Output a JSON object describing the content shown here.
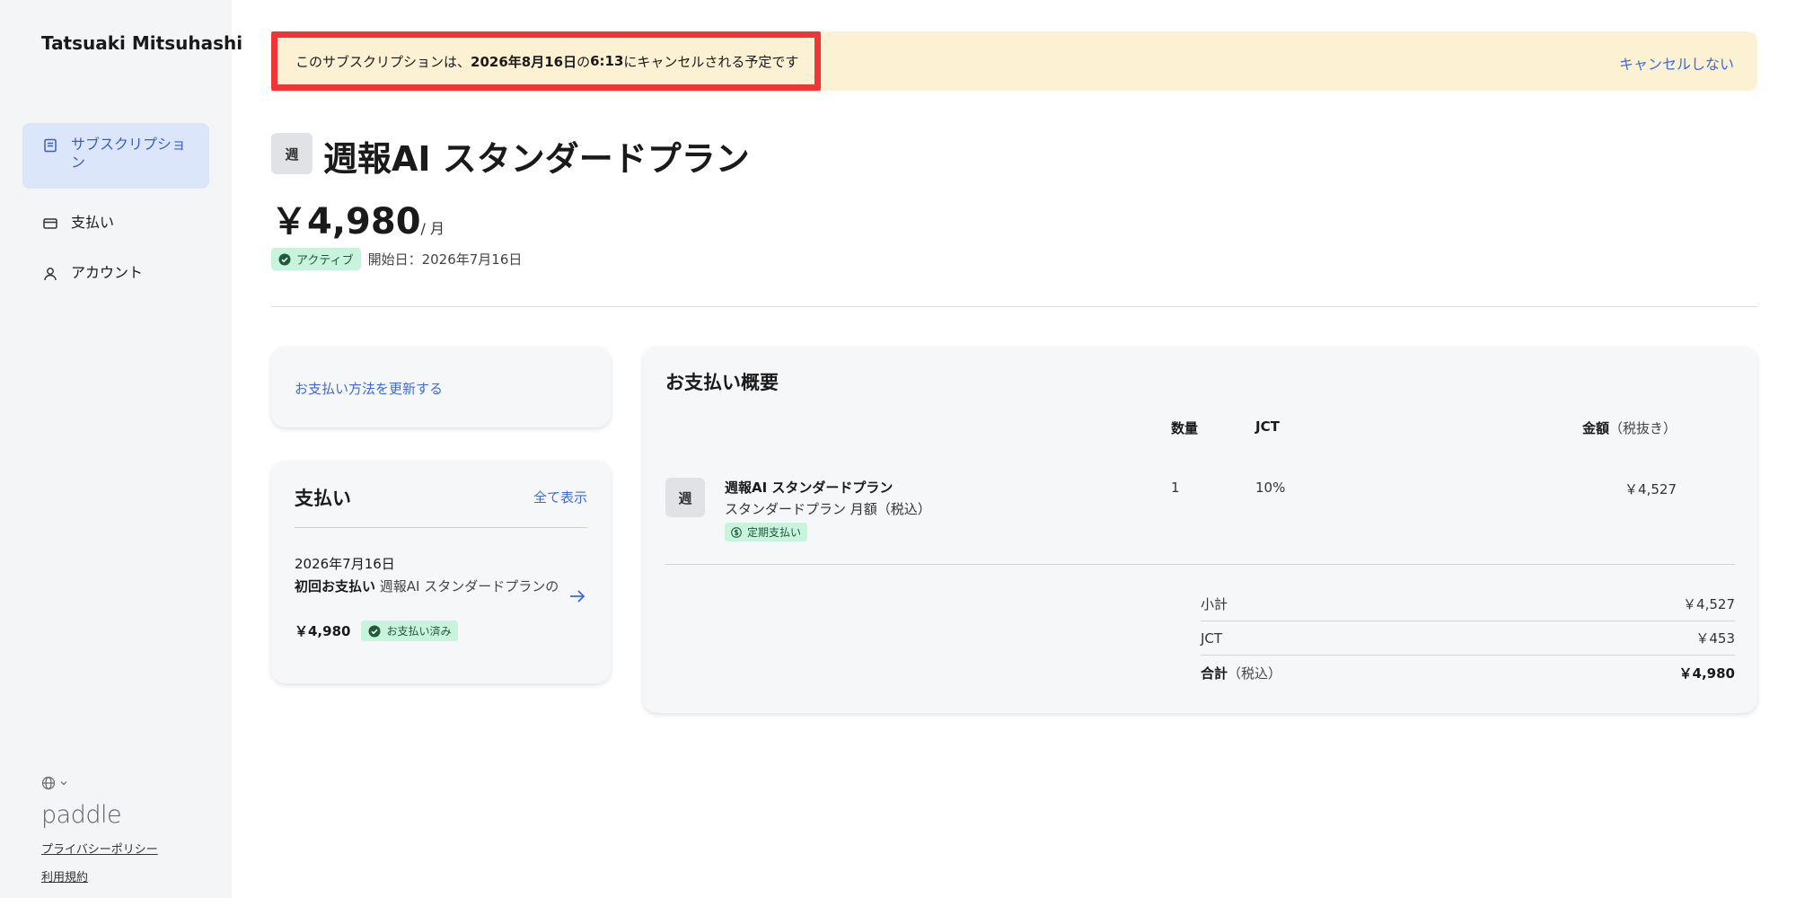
{
  "sidebar": {
    "user_name": "Tatsuaki Mitsuhashi",
    "nav": [
      {
        "label": "サブスクリプション",
        "icon": "subscription-icon",
        "active": true
      },
      {
        "label": "支払い",
        "icon": "card-icon",
        "active": false
      },
      {
        "label": "アカウント",
        "icon": "user-icon",
        "active": false
      }
    ],
    "language_icon": "globe-icon",
    "logo_text": "paddle",
    "privacy_link": "プライバシーポリシー",
    "terms_link": "利用規約"
  },
  "banner": {
    "prefix": "このサブスクリプションは、",
    "date": "2026年8月16日",
    "middle": "の",
    "time": "6:13",
    "suffix": "にキャンセルされる予定です",
    "action": "キャンセルしない"
  },
  "plan": {
    "avatar": "週",
    "title": "週報AI スタンダードプラン",
    "price": "￥4,980",
    "price_unit": "/ 月",
    "status": "アクティブ",
    "start_date": "開始日：2026年7月16日"
  },
  "update_card": {
    "link": "お支払い方法を更新する"
  },
  "payments_card": {
    "title": "支払い",
    "see_all": "全て表示",
    "date": "2026年7月16日",
    "desc_bold": "初回お支払い",
    "desc_rest": " 週報AI スタンダードプランの",
    "amount": "￥4,980",
    "status": "お支払い済み"
  },
  "summary": {
    "title": "お支払い概要",
    "columns": {
      "qty": "数量",
      "jct": "JCT",
      "amount": "金額",
      "amount_note": "（税抜き）"
    },
    "item": {
      "avatar": "週",
      "name": "週報AI スタンダードプラン",
      "sub": "スタンダードプラン 月額（税込）",
      "badge": "定期支払い",
      "qty": "1",
      "jct": "10%",
      "amount": "￥4,527"
    },
    "subtotal_label": "小計",
    "subtotal": "￥4,527",
    "jct_label": "JCT",
    "jct_amount": "￥453",
    "total_label": "合計",
    "total_note": "（税込）",
    "total": "￥4,980"
  },
  "colors": {
    "accent": "#3f6bd1",
    "banner_bg": "#fdf1d4",
    "highlight_border": "#ef3535",
    "badge_bg": "#c8f3dc"
  }
}
